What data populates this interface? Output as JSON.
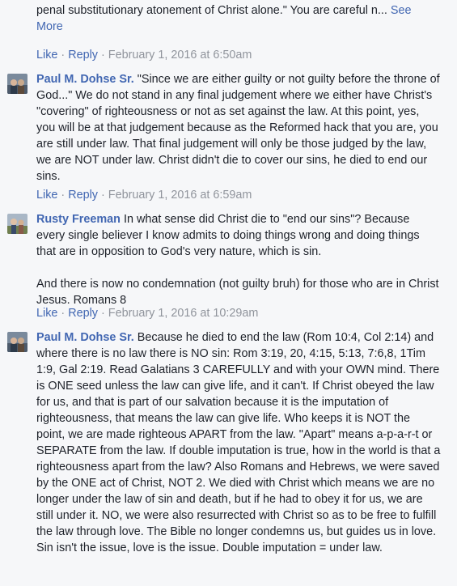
{
  "comments": [
    {
      "body": "time instantaneous act whereby God counts a sinner righteous based on the penal substitutionary atonement of Christ alone.\" You are careful n...",
      "see_more": "See More",
      "like": "Like",
      "reply": "Reply",
      "date": "February 1, 2016 at 6:50am"
    },
    {
      "author": "Paul M. Dohse Sr.",
      "body": "\"Since we are either guilty or not guilty before the throne of God...\" We do not stand in any final judgement where we either have Christ's \"covering\" of righteousness or not as set against the law. At this point, yes, you will be at that judgement because as the Reformed hack that you are, you are still under law. That final judgement will only be those judged by the law, we are NOT under law. Christ didn't die to cover our sins, he died to end our sins.",
      "like": "Like",
      "reply": "Reply",
      "date": "February 1, 2016 at 6:59am"
    },
    {
      "author": "Rusty Freeman",
      "body": "In what sense did Christ die to \"end our sins\"? Because every single believer I know admits to doing things wrong and doing things that are in opposition to God's very nature, which is sin.",
      "body2": "And there is now no condemnation (not guilty bruh) for those who are in Christ Jesus. Romans 8",
      "like": "Like",
      "reply": "Reply",
      "date": "February 1, 2016 at 10:29am"
    },
    {
      "author": "Paul M. Dohse Sr.",
      "body": "Because he died to end the law (Rom 10:4, Col 2:14) and where there is no law there is NO sin: Rom 3:19, 20, 4:15, 5:13, 7:6,8, 1Tim 1:9, Gal 2:19. Read Galatians 3 CAREFULLY and with your OWN mind. There is ONE seed unless the law can give life, and it can't. If Christ obeyed the law for us, and that is part of our salvation because it is the imputation of righteousness, that means the law can give life. Who keeps it is NOT the point, we are made righteous APART from the law. \"Apart\" means a-p-a-r-t or SEPARATE from the law. If double imputation is true, how in the world is that a righteousness apart from the law? Also Romans and Hebrews, we were saved by the ONE act of Christ, NOT 2. We died with Christ which means we are no longer under the law of sin and death, but if he had to obey it for us, we are still under it. NO, we were also resurrected with Christ so as to be free to fulfill the law through love. The Bible no longer condemns us, but guides us in love. Sin isn't the issue, love is the issue. Double imputation = under law."
    }
  ],
  "separator": "·"
}
